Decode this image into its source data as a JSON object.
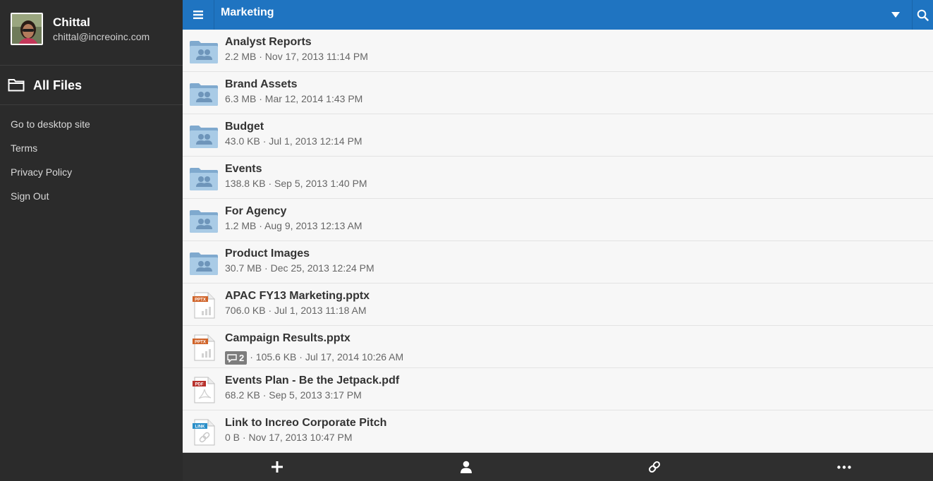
{
  "profile": {
    "name": "Chittal",
    "email": "chittal@increoinc.com"
  },
  "sidebar": {
    "all_files": "All Files",
    "links": [
      "Go to desktop site",
      "Terms",
      "Privacy Policy",
      "Sign Out"
    ]
  },
  "topbar": {
    "title": "Marketing"
  },
  "files": [
    {
      "name": "Analyst Reports",
      "meta": "2.2 MB · Nov 17, 2013 11:14 PM",
      "type": "folder"
    },
    {
      "name": "Brand Assets",
      "meta": "6.3 MB · Mar 12, 2014 1:43 PM",
      "type": "folder"
    },
    {
      "name": "Budget",
      "meta": "43.0 KB · Jul 1, 2013 12:14 PM",
      "type": "folder"
    },
    {
      "name": "Events",
      "meta": "138.8 KB · Sep 5, 2013 1:40 PM",
      "type": "folder"
    },
    {
      "name": "For Agency",
      "meta": "1.2 MB · Aug 9, 2013 12:13 AM",
      "type": "folder"
    },
    {
      "name": "Product Images",
      "meta": "30.7 MB · Dec 25, 2013 12:24 PM",
      "type": "folder"
    },
    {
      "name": "APAC FY13 Marketing.pptx",
      "meta": "706.0 KB · Jul 1, 2013 11:18 AM",
      "type": "pptx",
      "badge": "PPTX"
    },
    {
      "name": "Campaign Results.pptx",
      "comments": "2",
      "meta": "· 105.6 KB · Jul 17, 2014 10:26 AM",
      "type": "pptx",
      "badge": "PPTX"
    },
    {
      "name": "Events Plan - Be the Jetpack.pdf",
      "meta": "68.2 KB · Sep 5, 2013 3:17 PM",
      "type": "pdf",
      "badge": "PDF"
    },
    {
      "name": "Link to Increo Corporate Pitch",
      "meta": "0 B · Nov 17, 2013 10:47 PM",
      "type": "link",
      "badge": "LINK"
    }
  ],
  "icons": {
    "menu": "hamburger-icon",
    "caret": "caret-down-icon",
    "search": "search-icon",
    "add": "plus-icon",
    "share": "person-icon",
    "link": "link-icon",
    "more": "more-icon"
  },
  "colors": {
    "topbar": "#1f74c1",
    "sidebar": "#2b2b2b",
    "pptx": "#d0642a",
    "pdf": "#b8322d",
    "link": "#2a8fc9",
    "folder": "#8fb7d9"
  }
}
